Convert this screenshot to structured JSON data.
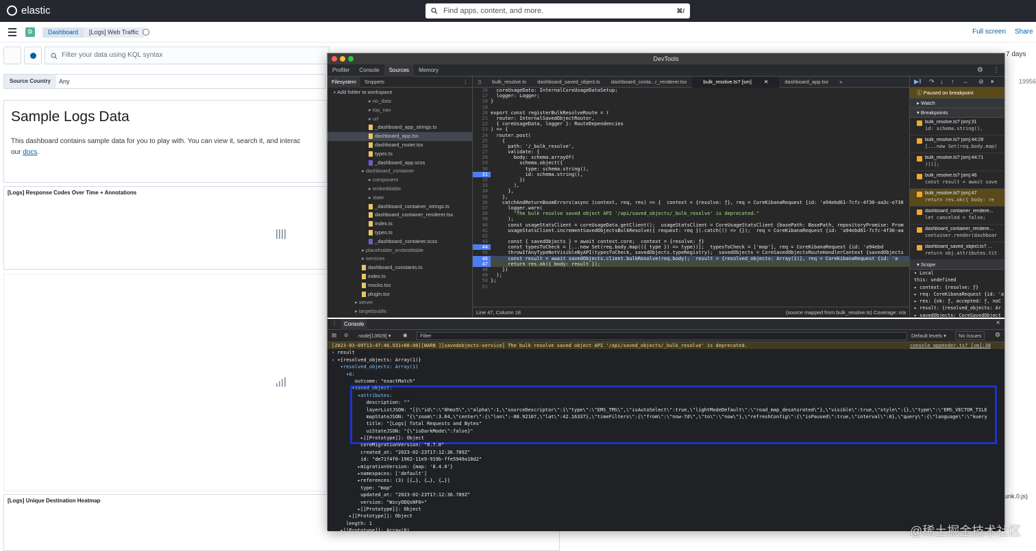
{
  "header": {
    "brand": "elastic",
    "search_placeholder": "Find apps, content, and more.",
    "search_shortcut": "⌘/"
  },
  "nav": {
    "space_initial": "D",
    "breadcrumb_1": "Dashboard",
    "breadcrumb_2": "[Logs] Web Traffic",
    "full_screen": "Full screen",
    "share": "Share"
  },
  "query": {
    "placeholder": "Filter your data using KQL syntax",
    "time_range": "7 days"
  },
  "controls": {
    "label": "Source Country",
    "value": "Any",
    "right_partial": "19956"
  },
  "panels": {
    "markdown_title": "Sample Logs Data",
    "markdown_text": "This dashboard contains sample data for you to play with. You can view it, search it, and interac",
    "markdown_text2": "our",
    "docs_link": "docs",
    "response_codes_title": "[Logs] Response Codes Over Time + Annotations",
    "heatmap_title": "[Logs] Unique Destination Heatmap",
    "bottom_right_text": "unk.0.js)"
  },
  "devtools": {
    "title": "DevTools",
    "tabs": [
      "Profiler",
      "Console",
      "Sources",
      "Memory"
    ],
    "nav_tabs": [
      "Filesystem",
      "Snippets"
    ],
    "add_folder": "+ Add folder to workspace",
    "tree": [
      {
        "label": "no_data",
        "indent": 60,
        "type": "folder"
      },
      {
        "label": "top_nav",
        "indent": 60,
        "type": "folder"
      },
      {
        "label": "url",
        "indent": 60,
        "type": "folder"
      },
      {
        "label": "_dashboard_app_strings.ts",
        "indent": 60,
        "type": "file"
      },
      {
        "label": "dashboard_app.tsx",
        "indent": 60,
        "type": "file",
        "selected": true
      },
      {
        "label": "dashboard_router.tsx",
        "indent": 60,
        "type": "file"
      },
      {
        "label": "types.ts",
        "indent": 60,
        "type": "file"
      },
      {
        "label": "_dashboard_app.scss",
        "indent": 60,
        "type": "scss"
      },
      {
        "label": "dashboard_container",
        "indent": 50,
        "type": "folder"
      },
      {
        "label": "component",
        "indent": 60,
        "type": "folder"
      },
      {
        "label": "embeddable",
        "indent": 60,
        "type": "folder"
      },
      {
        "label": "state",
        "indent": 60,
        "type": "folder"
      },
      {
        "label": "_dashboard_container_strings.ts",
        "indent": 60,
        "type": "file"
      },
      {
        "label": "dashboard_container_renderer.tsx",
        "indent": 60,
        "type": "file"
      },
      {
        "label": "index.ts",
        "indent": 60,
        "type": "file"
      },
      {
        "label": "types.ts",
        "indent": 60,
        "type": "file"
      },
      {
        "label": "_dashboard_container.scss",
        "indent": 60,
        "type": "scss"
      },
      {
        "label": "placeholder_embeddable",
        "indent": 50,
        "type": "folder"
      },
      {
        "label": "services",
        "indent": 50,
        "type": "folder"
      },
      {
        "label": "dashboard_constants.ts",
        "indent": 50,
        "type": "file"
      },
      {
        "label": "index.ts",
        "indent": 50,
        "type": "file"
      },
      {
        "label": "mocks.tsx",
        "indent": 50,
        "type": "file"
      },
      {
        "label": "plugin.tsx",
        "indent": 50,
        "type": "file"
      },
      {
        "label": "server",
        "indent": 40,
        "type": "folder"
      },
      {
        "label": "target/public",
        "indent": 40,
        "type": "folder"
      }
    ],
    "editor_tabs": [
      "bulk_resolve.ts",
      "dashboard_saved_object.ts",
      "dashboard_conta...r_renderer.tsx",
      "bulk_resolve.ts? [sm]",
      "dashboard_app.tsx",
      "»"
    ],
    "code_lines": [
      {
        "n": "16",
        "t": "  coreUsageData: InternalCoreUsageDataSetup;"
      },
      {
        "n": "17",
        "t": "  logger: Logger;"
      },
      {
        "n": "18",
        "t": "}"
      },
      {
        "n": "19",
        "t": ""
      },
      {
        "n": "20",
        "t": "export const registerBulkResolveRoute = ("
      },
      {
        "n": "21",
        "t": "  router: InternalSavedObjectRouter,"
      },
      {
        "n": "22",
        "t": "  { coreUsageData, logger }: RouteDependencies"
      },
      {
        "n": "23",
        "t": ") => {"
      },
      {
        "n": "24",
        "t": "  router.post("
      },
      {
        "n": "25",
        "t": "    {"
      },
      {
        "n": "26",
        "t": "      path: '/_bulk_resolve',"
      },
      {
        "n": "27",
        "t": "      validate: {"
      },
      {
        "n": "28",
        "t": "        body: schema.arrayOf("
      },
      {
        "n": "29",
        "t": "          schema.object({"
      },
      {
        "n": "30",
        "t": "            type: schema.string(),"
      },
      {
        "n": "31",
        "t": "            id: schema.string(),",
        "bp": true
      },
      {
        "n": "32",
        "t": "          })"
      },
      {
        "n": "33",
        "t": "        ),"
      },
      {
        "n": "34",
        "t": "      },"
      },
      {
        "n": "35",
        "t": "    },"
      },
      {
        "n": "36",
        "t": "    catchAndReturnBoomErrors(async (context, req, res) => {  context = {resolve: ƒ}, req = CoreKibanaRequest {id: 'a94ebd61-7cfc-4f30-aa3c-e730"
      },
      {
        "n": "37",
        "t": "      logger.warn("
      },
      {
        "n": "38",
        "t": "        \"The bulk resolve saved object API '/api/saved_objects/_bulk_resolve' is deprecated.\""
      },
      {
        "n": "39",
        "t": "      );"
      },
      {
        "n": "40",
        "t": "      const usageStatsClient = coreUsageData.getClient();  usageStatsClient = CoreUsageStatsClient {basePath: BasePath, repositoryPromise: Prom"
      },
      {
        "n": "41",
        "t": "      usageStatsClient.incrementSavedObjectsBulkResolve({ request: req }).catch(() => {});  req = CoreKibanaRequest {id: 'a94ebd61-7cfc-4f30-aa"
      },
      {
        "n": "42",
        "t": ""
      },
      {
        "n": "43",
        "t": "      const { savedObjects } = await context.core;  context = {resolve: ƒ}"
      },
      {
        "n": "44",
        "t": "      const typesToCheck = [...new Set(req.body.map(({ type }) => type))];  typesToCheck = ['map'], req = CoreKibanaRequest {id: 'a94ebd",
        "bp": true
      },
      {
        "n": "45",
        "t": "      throwIfAnyTypeNotVisibleByAPI(typesToCheck, savedObjects.typeRegistry);  savedObjects = CoreSavedObjectsRouteHandlerContext {savedObjects"
      },
      {
        "n": "46",
        "t": "      const result = await savedObjects.client.bulkResolve(req.body);  result = {resolved_objects: Array(1)}, req = CoreKibanaRequest {id: 'a",
        "bp": true,
        "hl": true
      },
      {
        "n": "47",
        "t": "      return res.ok({ body: result });",
        "bp": true,
        "cur": true
      },
      {
        "n": "48",
        "t": "    })"
      },
      {
        "n": "49",
        "t": "  );"
      },
      {
        "n": "50",
        "t": "};"
      },
      {
        "n": "51",
        "t": ""
      }
    ],
    "status_position": "Line 47, Column 18",
    "status_mapped": "(source mapped from bulk_resolve.ts) Coverage: n/a",
    "paused": "Paused on breakpoint",
    "watch": "Watch",
    "breakpoints_label": "Breakpoints",
    "breakpoints": [
      {
        "file": "bulk_resolve.ts? [sm]:31",
        "code": "id: schema.string(),"
      },
      {
        "file": "bulk_resolve.ts? [sm]:44:28",
        "code": "[...new Set(req.body.map("
      },
      {
        "file": "bulk_resolve.ts? [sm]:44:71",
        "code": ")))];"
      },
      {
        "file": "bulk_resolve.ts? [sm]:46",
        "code": "const result = await save"
      },
      {
        "file": "bulk_resolve.ts? [sm]:47",
        "code": "return res.ok({ body: re",
        "active": true
      },
      {
        "file": "dashboard_container_rendere...",
        "code": "let canceled = false;"
      },
      {
        "file": "dashboard_container_rendere...",
        "code": "container.render(dashboar"
      },
      {
        "file": "dashboard_saved_object.ts? ...",
        "code": "return obj.attributes.tit"
      }
    ],
    "scope_label": "Scope",
    "scope_lines": [
      "▾ Local",
      "   this: undefined",
      " ▸ context: {resolve: ƒ}",
      " ▸ req: CoreKibanaRequest {id: 'a",
      " ▸ res: {ok: ƒ, accepted: ƒ, noC",
      " ▸ result: {resolved_objects: Ar",
      " ▸ savedObjects: CoreSavedObject"
    ],
    "console_tab": "Console",
    "context_select": "node[13609]",
    "filter_placeholder": "Filter",
    "levels": "Default levels",
    "issues": "No Issues",
    "console_lines": [
      {
        "t": "[2023-03-09T13:47:46.931+08:00][WARN ][savedobjects-service] The bulk resolve saved object API '/api/saved_objects/_bulk_resolve' is deprecated.",
        "cls": "warn",
        "src": "console_appender.ts? [sm]:38"
      },
      {
        "t": "› result",
        "cls": ""
      },
      {
        "t": "‹ ▾{resolved_objects: Array(1)}",
        "cls": ""
      },
      {
        "t": "   ▾resolved_objects: Array(1)",
        "cls": "key"
      },
      {
        "t": "     ▾0:",
        "cls": "key"
      },
      {
        "t": "        outcome: \"exactMatch\"",
        "cls": ""
      },
      {
        "t": "       ▾saved_object:",
        "cls": "key"
      },
      {
        "t": "         ▾attributes:",
        "cls": "key"
      },
      {
        "t": "            description: \"\"",
        "cls": ""
      },
      {
        "t": "            layerListJSON: \"[{\\\"id\\\":\\\"0hmz5\\\",\\\"alpha\\\":1,\\\"sourceDescriptor\\\":{\\\"type\\\":\\\"EMS_TMS\\\",\\\"isAutoSelect\\\":true,\\\"lightModeDefault\\\":\\\"road_map_desaturated\\\"},\\\"visible\\\":true,\\\"style\\\":{},\\\"type\\\":\\\"EMS_VECTOR_TILE",
        "cls": ""
      },
      {
        "t": "            mapStateJSON: \"{\\\"zoom\\\":3.64,\\\"center\\\":{\\\"lon\\\":-88.92107,\\\"lat\\\":42.16337},\\\"timeFilters\\\":{\\\"from\\\":\\\"now-7d\\\",\\\"to\\\":\\\"now\\\"},\\\"refreshConfig\\\":{\\\"isPaused\\\":true,\\\"interval\\\":0},\\\"query\\\":{\\\"language\\\":\\\"kuery",
        "cls": ""
      },
      {
        "t": "            title: \"[Logs] Total Requests and Bytes\"",
        "cls": ""
      },
      {
        "t": "            uiStateJSON: \"{\\\"isDarkMode\\\":false}\"",
        "cls": ""
      },
      {
        "t": "          ▸[[Prototype]]: Object",
        "cls": ""
      },
      {
        "t": "          coreMigrationVersion: \"8.7.0\"",
        "cls": ""
      },
      {
        "t": "          created_at: \"2023-02-23T17:12:36.789Z\"",
        "cls": ""
      },
      {
        "t": "          id: \"de71f4f0-1902-11e9-919b-ffe5949a18d2\"",
        "cls": ""
      },
      {
        "t": "         ▸migrationVersion: {map: '8.4.0'}",
        "cls": ""
      },
      {
        "t": "         ▸namespaces: ['default']",
        "cls": ""
      },
      {
        "t": "         ▸references: (3) [{…}, {…}, {…}]",
        "cls": ""
      },
      {
        "t": "          type: \"map\"",
        "cls": ""
      },
      {
        "t": "          updated_at: \"2023-02-23T17:12:36.789Z\"",
        "cls": ""
      },
      {
        "t": "          version: \"WzcyODQsNF0=\"",
        "cls": ""
      },
      {
        "t": "         ▸[[Prototype]]: Object",
        "cls": ""
      },
      {
        "t": "      ▸[[Prototype]]: Object",
        "cls": ""
      },
      {
        "t": "     length: 1",
        "cls": ""
      },
      {
        "t": "   ▸[[Prototype]]: Array(0)",
        "cls": ""
      }
    ]
  },
  "watermark": "@稀土掘金技术社区"
}
